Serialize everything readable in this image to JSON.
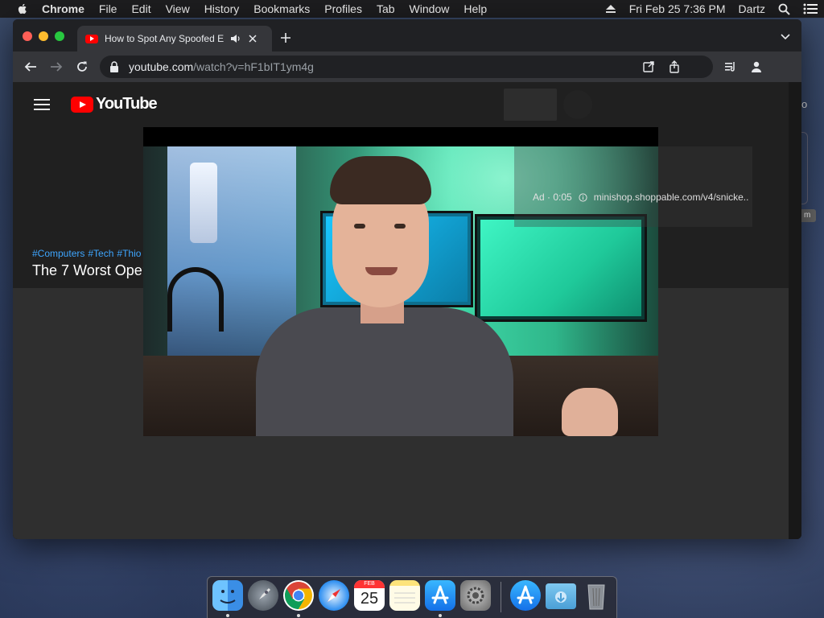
{
  "menubar": {
    "app_name": "Chrome",
    "items": [
      "File",
      "Edit",
      "View",
      "History",
      "Bookmarks",
      "Profiles",
      "Tab",
      "Window",
      "Help"
    ],
    "datetime": "Fri Feb 25  7:36 PM",
    "user": "Dartz"
  },
  "browser": {
    "tab_title": "How to Spot Any Spoofed E",
    "url_host": "youtube.com",
    "url_path": "/watch?v=hF1bIT1ym4g"
  },
  "youtube": {
    "logo_text": "YouTube",
    "hashtags": [
      "#Computers",
      "#Tech",
      "#Thio"
    ],
    "video_title": "The 7 Worst Oper"
  },
  "video": {
    "ad_label": "Ad · 0:05",
    "ad_url": "minishop.shoppable.com/v4/snicke.."
  },
  "desktop": {
    "edge_text": "o",
    "edge_tag": "m"
  },
  "dock": {
    "calendar_month": "FEB",
    "calendar_day": "25"
  },
  "colors": {
    "youtube_red": "#ff0000",
    "link_blue": "#3ea6ff",
    "chrome_dark": "#35363a"
  }
}
